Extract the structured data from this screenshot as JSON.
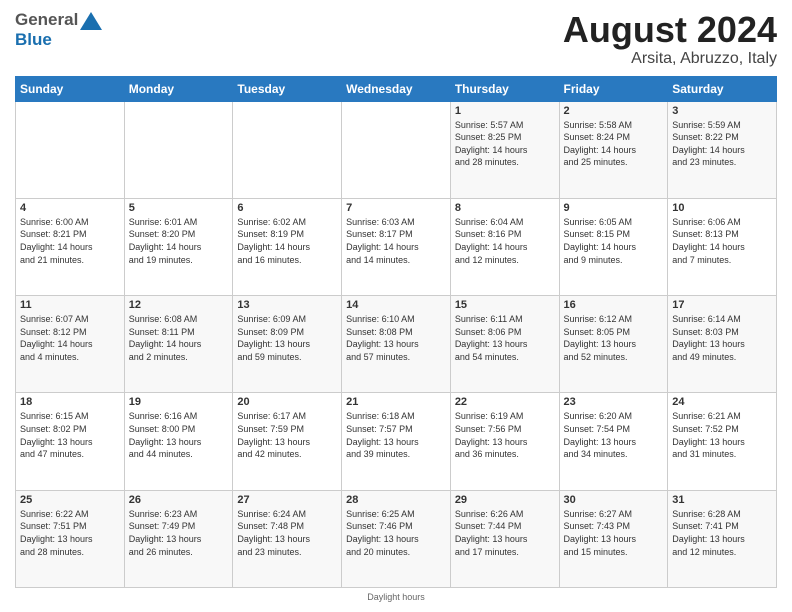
{
  "header": {
    "logo_general": "General",
    "logo_blue": "Blue",
    "main_title": "August 2024",
    "subtitle": "Arsita, Abruzzo, Italy"
  },
  "days_of_week": [
    "Sunday",
    "Monday",
    "Tuesday",
    "Wednesday",
    "Thursday",
    "Friday",
    "Saturday"
  ],
  "footer_note": "Daylight hours",
  "weeks": [
    [
      {
        "day": "",
        "info": ""
      },
      {
        "day": "",
        "info": ""
      },
      {
        "day": "",
        "info": ""
      },
      {
        "day": "",
        "info": ""
      },
      {
        "day": "1",
        "info": "Sunrise: 5:57 AM\nSunset: 8:25 PM\nDaylight: 14 hours\nand 28 minutes."
      },
      {
        "day": "2",
        "info": "Sunrise: 5:58 AM\nSunset: 8:24 PM\nDaylight: 14 hours\nand 25 minutes."
      },
      {
        "day": "3",
        "info": "Sunrise: 5:59 AM\nSunset: 8:22 PM\nDaylight: 14 hours\nand 23 minutes."
      }
    ],
    [
      {
        "day": "4",
        "info": "Sunrise: 6:00 AM\nSunset: 8:21 PM\nDaylight: 14 hours\nand 21 minutes."
      },
      {
        "day": "5",
        "info": "Sunrise: 6:01 AM\nSunset: 8:20 PM\nDaylight: 14 hours\nand 19 minutes."
      },
      {
        "day": "6",
        "info": "Sunrise: 6:02 AM\nSunset: 8:19 PM\nDaylight: 14 hours\nand 16 minutes."
      },
      {
        "day": "7",
        "info": "Sunrise: 6:03 AM\nSunset: 8:17 PM\nDaylight: 14 hours\nand 14 minutes."
      },
      {
        "day": "8",
        "info": "Sunrise: 6:04 AM\nSunset: 8:16 PM\nDaylight: 14 hours\nand 12 minutes."
      },
      {
        "day": "9",
        "info": "Sunrise: 6:05 AM\nSunset: 8:15 PM\nDaylight: 14 hours\nand 9 minutes."
      },
      {
        "day": "10",
        "info": "Sunrise: 6:06 AM\nSunset: 8:13 PM\nDaylight: 14 hours\nand 7 minutes."
      }
    ],
    [
      {
        "day": "11",
        "info": "Sunrise: 6:07 AM\nSunset: 8:12 PM\nDaylight: 14 hours\nand 4 minutes."
      },
      {
        "day": "12",
        "info": "Sunrise: 6:08 AM\nSunset: 8:11 PM\nDaylight: 14 hours\nand 2 minutes."
      },
      {
        "day": "13",
        "info": "Sunrise: 6:09 AM\nSunset: 8:09 PM\nDaylight: 13 hours\nand 59 minutes."
      },
      {
        "day": "14",
        "info": "Sunrise: 6:10 AM\nSunset: 8:08 PM\nDaylight: 13 hours\nand 57 minutes."
      },
      {
        "day": "15",
        "info": "Sunrise: 6:11 AM\nSunset: 8:06 PM\nDaylight: 13 hours\nand 54 minutes."
      },
      {
        "day": "16",
        "info": "Sunrise: 6:12 AM\nSunset: 8:05 PM\nDaylight: 13 hours\nand 52 minutes."
      },
      {
        "day": "17",
        "info": "Sunrise: 6:14 AM\nSunset: 8:03 PM\nDaylight: 13 hours\nand 49 minutes."
      }
    ],
    [
      {
        "day": "18",
        "info": "Sunrise: 6:15 AM\nSunset: 8:02 PM\nDaylight: 13 hours\nand 47 minutes."
      },
      {
        "day": "19",
        "info": "Sunrise: 6:16 AM\nSunset: 8:00 PM\nDaylight: 13 hours\nand 44 minutes."
      },
      {
        "day": "20",
        "info": "Sunrise: 6:17 AM\nSunset: 7:59 PM\nDaylight: 13 hours\nand 42 minutes."
      },
      {
        "day": "21",
        "info": "Sunrise: 6:18 AM\nSunset: 7:57 PM\nDaylight: 13 hours\nand 39 minutes."
      },
      {
        "day": "22",
        "info": "Sunrise: 6:19 AM\nSunset: 7:56 PM\nDaylight: 13 hours\nand 36 minutes."
      },
      {
        "day": "23",
        "info": "Sunrise: 6:20 AM\nSunset: 7:54 PM\nDaylight: 13 hours\nand 34 minutes."
      },
      {
        "day": "24",
        "info": "Sunrise: 6:21 AM\nSunset: 7:52 PM\nDaylight: 13 hours\nand 31 minutes."
      }
    ],
    [
      {
        "day": "25",
        "info": "Sunrise: 6:22 AM\nSunset: 7:51 PM\nDaylight: 13 hours\nand 28 minutes."
      },
      {
        "day": "26",
        "info": "Sunrise: 6:23 AM\nSunset: 7:49 PM\nDaylight: 13 hours\nand 26 minutes."
      },
      {
        "day": "27",
        "info": "Sunrise: 6:24 AM\nSunset: 7:48 PM\nDaylight: 13 hours\nand 23 minutes."
      },
      {
        "day": "28",
        "info": "Sunrise: 6:25 AM\nSunset: 7:46 PM\nDaylight: 13 hours\nand 20 minutes."
      },
      {
        "day": "29",
        "info": "Sunrise: 6:26 AM\nSunset: 7:44 PM\nDaylight: 13 hours\nand 17 minutes."
      },
      {
        "day": "30",
        "info": "Sunrise: 6:27 AM\nSunset: 7:43 PM\nDaylight: 13 hours\nand 15 minutes."
      },
      {
        "day": "31",
        "info": "Sunrise: 6:28 AM\nSunset: 7:41 PM\nDaylight: 13 hours\nand 12 minutes."
      }
    ]
  ]
}
